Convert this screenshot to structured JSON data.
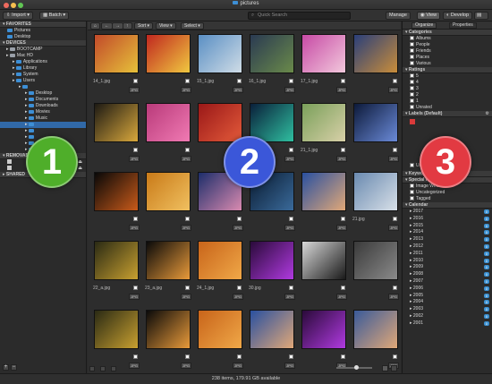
{
  "window": {
    "title": "pictures"
  },
  "toolbar": {
    "import": "Import",
    "batch": "Batch",
    "search_placeholder": "Quick Search",
    "manage": "Manage",
    "view": "View",
    "develop": "Develop"
  },
  "sidebar": {
    "favorites_title": "FAVORITES",
    "favorites": [
      "Pictures",
      "Desktop"
    ],
    "devices_title": "DEVICES",
    "devices": [
      {
        "label": "BOOTCAMP",
        "indent": 1
      },
      {
        "label": "Mac HD",
        "indent": 1
      },
      {
        "label": "Applications",
        "indent": 2
      },
      {
        "label": "Library",
        "indent": 2
      },
      {
        "label": "System",
        "indent": 2
      },
      {
        "label": "Users",
        "indent": 2
      },
      {
        "label": "",
        "indent": 3
      },
      {
        "label": "Desktop",
        "indent": 4
      },
      {
        "label": "Documents",
        "indent": 4
      },
      {
        "label": "Downloads",
        "indent": 4
      },
      {
        "label": "Movies",
        "indent": 4
      },
      {
        "label": "Music",
        "indent": 4
      },
      {
        "label": "",
        "indent": 4
      },
      {
        "label": "",
        "indent": 4
      },
      {
        "label": "",
        "indent": 4
      },
      {
        "label": "",
        "indent": 4
      },
      {
        "label": "",
        "indent": 4
      }
    ],
    "removable_title": "REMOVABLE",
    "shared_title": "SHARED"
  },
  "content_toolbar": {
    "sort": "Sort",
    "view": "View",
    "select": "Select"
  },
  "grid": [
    {
      "name": "14_1.jpg",
      "tag": "JPG",
      "c1": "#c24a2a",
      "c2": "#e6c13a"
    },
    {
      "name": "",
      "tag": "JPG",
      "c1": "#c0271f",
      "c2": "#f0c840"
    },
    {
      "name": "15_1.jpg",
      "tag": "JPG",
      "c1": "#5a8fc4",
      "c2": "#cfdce6"
    },
    {
      "name": "16_1.jpg",
      "tag": "JPG",
      "c1": "#2a3a52",
      "c2": "#6a8a4a"
    },
    {
      "name": "17_1.jpg",
      "tag": "JPG",
      "c1": "#c74aa5",
      "c2": "#f2c8dc"
    },
    {
      "name": "",
      "tag": "JPG",
      "c1": "#2a3f7a",
      "c2": "#c98d3a"
    },
    {
      "name": "",
      "tag": "JPG",
      "c1": "#1d1a14",
      "c2": "#d9a83c"
    },
    {
      "name": "",
      "tag": "JPG",
      "c1": "#b93a7a",
      "c2": "#f07ab3"
    },
    {
      "name": "",
      "tag": "JPG",
      "c1": "#9a1818",
      "c2": "#e35a3a"
    },
    {
      "name": "20_1.jpg",
      "tag": "JPG",
      "c1": "#0a1f3a",
      "c2": "#2fbfa0"
    },
    {
      "name": "21_1.jpg",
      "tag": "JPG",
      "c1": "#7aa05a",
      "c2": "#d8d0a8"
    },
    {
      "name": "",
      "tag": "JPG",
      "c1": "#0d1a3a",
      "c2": "#6a8ad8"
    },
    {
      "name": "",
      "tag": "JPG",
      "c1": "#080808",
      "c2": "#c85a1a"
    },
    {
      "name": "",
      "tag": "JPG",
      "c1": "#c97a18",
      "c2": "#f0c060"
    },
    {
      "name": "",
      "tag": "JPG",
      "c1": "#1d2e6a",
      "c2": "#d98ab0"
    },
    {
      "name": "",
      "tag": "JPG",
      "c1": "#091a30",
      "c2": "#3a6a9a"
    },
    {
      "name": "",
      "tag": "JPG",
      "c1": "#2a50a0",
      "c2": "#e0a878"
    },
    {
      "name": "21.jpg",
      "tag": "JPG",
      "c1": "#6a8ab0",
      "c2": "#d8e0e8"
    },
    {
      "name": "22_a.jpg",
      "tag": "JPG",
      "c1": "#2a2a14",
      "c2": "#c8a030"
    },
    {
      "name": "23_a.jpg",
      "tag": "JPG",
      "c1": "#0a0a0a",
      "c2": "#e89a3a"
    },
    {
      "name": "24_1.jpg",
      "tag": "JPG",
      "c1": "#c8641a",
      "c2": "#f0a848"
    },
    {
      "name": "30.jpg",
      "tag": "JPG",
      "c1": "#2a0a3a",
      "c2": "#b03ae0"
    },
    {
      "name": "",
      "tag": "JPG",
      "c1": "#d8d8d8",
      "c2": "#1a1a1a"
    },
    {
      "name": "",
      "tag": "JPG",
      "c1": "#3a3a3a",
      "c2": "#8a8a8a"
    },
    {
      "name": "",
      "tag": "JPG",
      "c1": "#2a2a14",
      "c2": "#c8a030"
    },
    {
      "name": "",
      "tag": "JPG",
      "c1": "#0a0a0a",
      "c2": "#e89a3a"
    },
    {
      "name": "",
      "tag": "JPG",
      "c1": "#c8641a",
      "c2": "#f0a848"
    },
    {
      "name": "",
      "tag": "JPG",
      "c1": "#2a50a0",
      "c2": "#e0a878"
    },
    {
      "name": "",
      "tag": "JPG",
      "c1": "#2a0a3a",
      "c2": "#b03ae0"
    },
    {
      "name": "",
      "tag": "JPG",
      "c1": "#3a5a9a",
      "c2": "#e0a878"
    }
  ],
  "right_tabs": {
    "organize": "Organize",
    "properties": "Properties"
  },
  "categories": {
    "title": "Categories",
    "items": [
      "Albums",
      "People",
      "Friends",
      "Places",
      "Various"
    ]
  },
  "ratings": {
    "title": "Ratings",
    "items": [
      "5",
      "4",
      "3",
      "2",
      "1",
      "Unrated"
    ]
  },
  "labels": {
    "title": "Labels (Default)",
    "unrated": "Unrated"
  },
  "keywords": {
    "title": "Keywords"
  },
  "special_items": {
    "title": "Special Items",
    "items": [
      "Image Well",
      "Uncategorized",
      "Tagged"
    ]
  },
  "calendar": {
    "title": "Calendar",
    "years": [
      {
        "label": "2017",
        "count": "0"
      },
      {
        "label": "2016",
        "count": "0"
      },
      {
        "label": "2015",
        "count": "0"
      },
      {
        "label": "2014",
        "count": "0"
      },
      {
        "label": "2013",
        "count": "0"
      },
      {
        "label": "2012",
        "count": "0"
      },
      {
        "label": "2011",
        "count": "0"
      },
      {
        "label": "2010",
        "count": "0"
      },
      {
        "label": "2009",
        "count": "0"
      },
      {
        "label": "2008",
        "count": "0"
      },
      {
        "label": "2007",
        "count": "0"
      },
      {
        "label": "2006",
        "count": "0"
      },
      {
        "label": "2005",
        "count": "0"
      },
      {
        "label": "2004",
        "count": "0"
      },
      {
        "label": "2003",
        "count": "0"
      },
      {
        "label": "2002",
        "count": "0"
      },
      {
        "label": "2001",
        "count": "0"
      }
    ]
  },
  "status": {
    "text": "238 items, 179.91 GB available"
  },
  "overlay": {
    "one": "1",
    "two": "2",
    "three": "3"
  },
  "colors": {
    "accent": "#3a8fd0",
    "badge1": "#4fae2a",
    "badge2": "#3b57d9",
    "badge3": "#e23a42"
  }
}
